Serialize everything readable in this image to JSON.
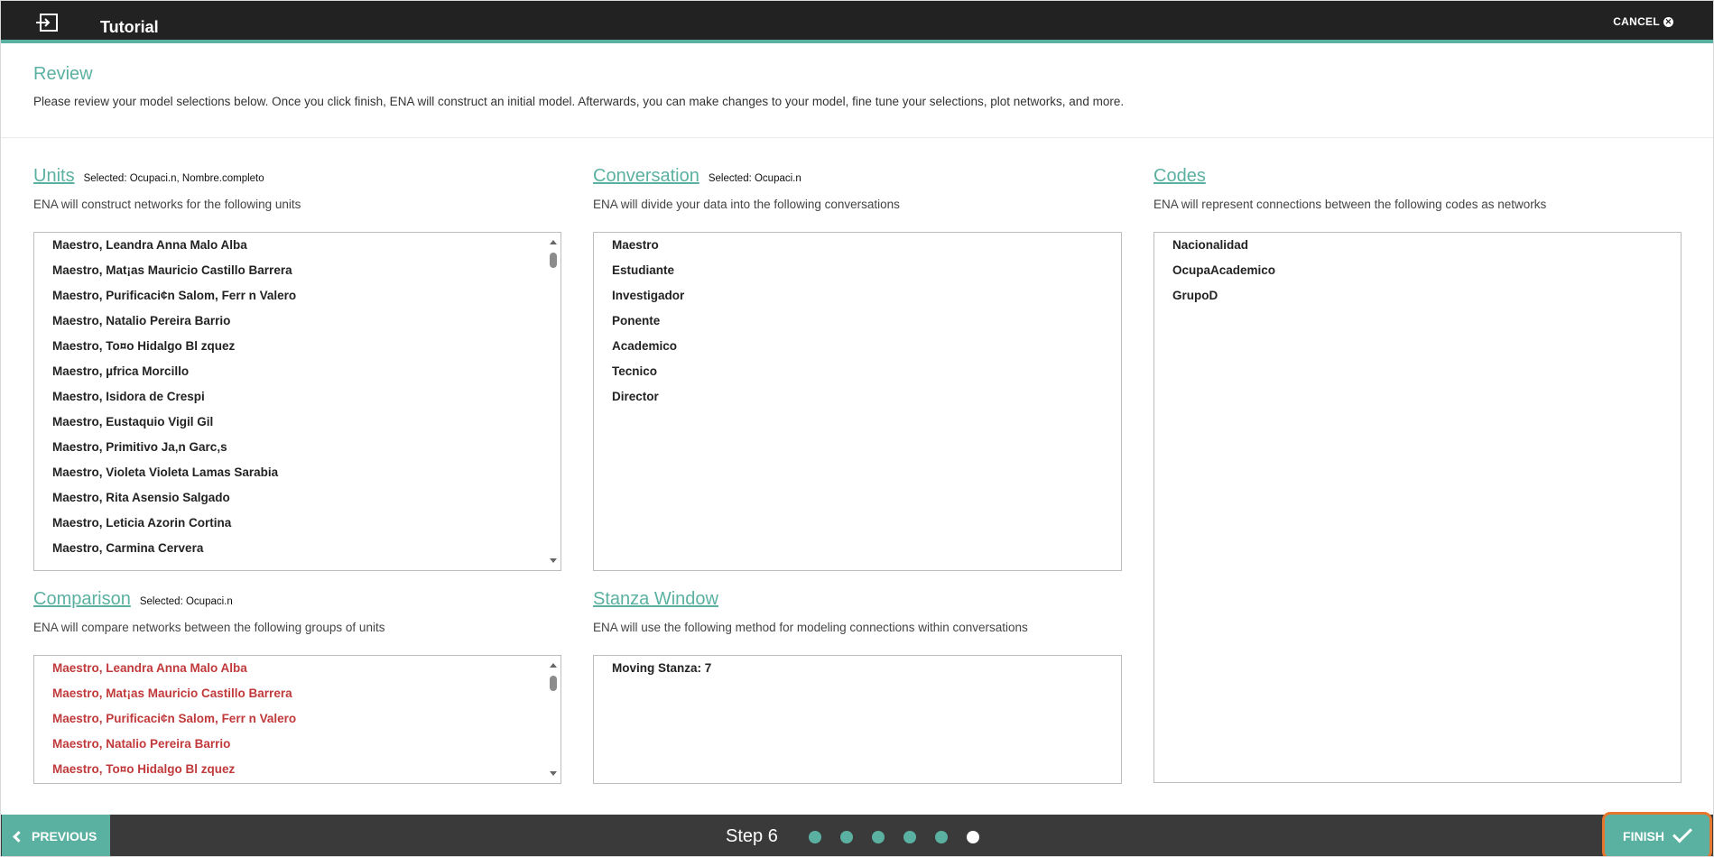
{
  "header": {
    "title": "Tutorial",
    "cancel_label": "CANCEL",
    "exit_icon": "exit-to-app-icon",
    "cancel_icon": "close-circle-icon",
    "accent": "#5bb1a1"
  },
  "review": {
    "heading": "Review",
    "text": "Please review your model selections below. Once you click finish, ENA will construct an initial model. Afterwards, you can make changes to your model, fine tune your selections, plot networks, and more."
  },
  "units": {
    "title": "Units",
    "selected": "Selected: Ocupaci.n, Nombre.completo",
    "description": "ENA will construct networks for the following units",
    "items": [
      "Maestro, Leandra Anna Malo Alba",
      "Maestro, Mat¡as Mauricio Castillo Barrera",
      "Maestro, Purificaci¢n Salom, Ferr n Valero",
      "Maestro, Natalio Pereira Barrio",
      "Maestro, To¤o Hidalgo Bl zquez",
      "Maestro, µfrica Morcillo",
      "Maestro, Isidora de Crespi",
      "Maestro, Eustaquio Vigil Gil",
      "Maestro, Primitivo Ja‚n Garc‚s",
      "Maestro, Violeta Violeta Lamas Sarabia",
      "Maestro, Rita Asensio Salgado",
      "Maestro, Leticia Azorin Cortina",
      "Maestro, Carmina Cervera"
    ]
  },
  "conversation": {
    "title": "Conversation",
    "selected": "Selected: Ocupaci.n",
    "description": "ENA will divide your data into the following conversations",
    "items": [
      "Maestro",
      "Estudiante",
      "Investigador",
      "Ponente",
      "Academico",
      "Tecnico",
      "Director"
    ]
  },
  "codes": {
    "title": "Codes",
    "description": "ENA will represent connections between the following codes as networks",
    "items": [
      "Nacionalidad",
      "OcupaAcademico",
      "GrupoD"
    ]
  },
  "comparison": {
    "title": "Comparison",
    "selected": "Selected: Ocupaci.n",
    "description": "ENA will compare networks between the following groups of units",
    "items": [
      "Maestro, Leandra Anna Malo Alba",
      "Maestro, Mat¡as Mauricio Castillo Barrera",
      "Maestro, Purificaci¢n Salom, Ferr n Valero",
      "Maestro, Natalio Pereira Barrio",
      "Maestro, To¤o Hidalgo Bl zquez"
    ],
    "item_color": "#c0393b"
  },
  "stanza": {
    "title": "Stanza Window",
    "description": "ENA will use the following method for modeling connections within conversations",
    "items": [
      "Moving Stanza: 7"
    ]
  },
  "footer": {
    "previous_label": "PREVIOUS",
    "step_label": "Step 6",
    "finish_label": "FINISH",
    "total_steps": 6,
    "current_step": 6
  }
}
